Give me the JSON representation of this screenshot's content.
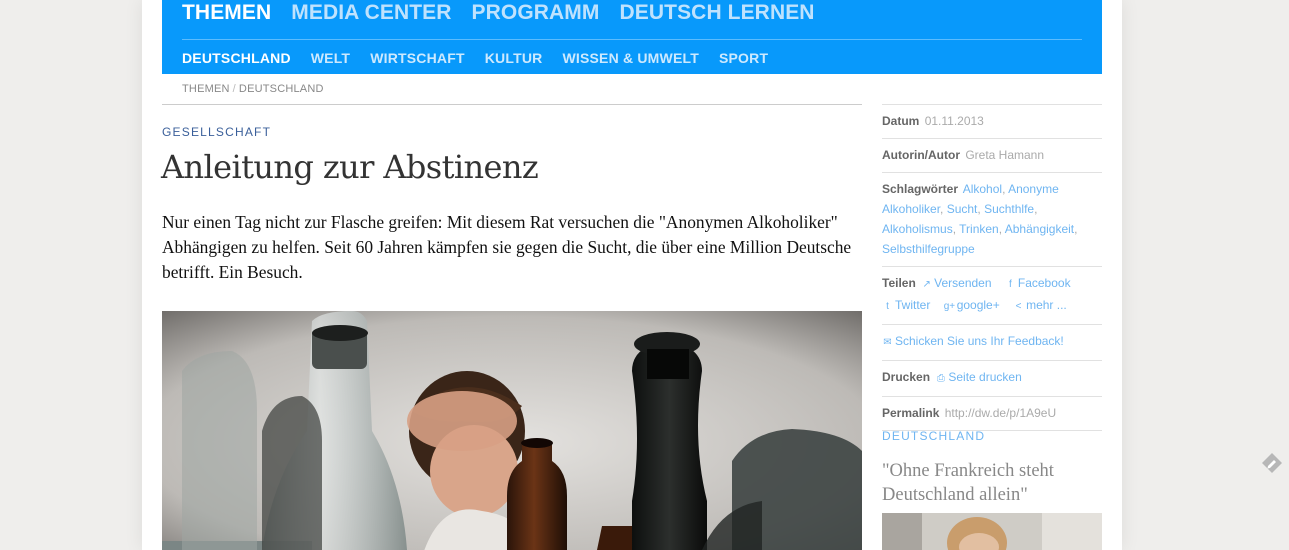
{
  "nav": {
    "main": [
      "THEMEN",
      "MEDIA CENTER",
      "PROGRAMM",
      "DEUTSCH LERNEN"
    ],
    "sub": [
      "DEUTSCHLAND",
      "WELT",
      "WIRTSCHAFT",
      "KULTUR",
      "WISSEN & UMWELT",
      "SPORT"
    ]
  },
  "breadcrumb": {
    "part1": "THEMEN",
    "sep": "/",
    "part2": "DEUTSCHLAND"
  },
  "article": {
    "kicker": "GESELLSCHAFT",
    "headline": "Anleitung zur Abstinenz",
    "teaser": "Nur einen Tag nicht zur Flasche greifen: Mit diesem Rat versuchen die \"Anonymen Alkoholiker\" Abhängigen zu helfen. Seit 60 Jahren kämpfen sie gegen die Sucht, die über eine Million Deutsche betrifft. Ein Besuch."
  },
  "sidebar": {
    "date_label": "Datum",
    "date_value": "01.11.2013",
    "author_label": "Autorin/Autor",
    "author_value": "Greta Hamann",
    "tags_label": "Schlagwörter",
    "tags": [
      "Alkohol",
      "Anonyme Alkoholiker",
      "Sucht",
      "Suchthlfe",
      "Alkoholismus",
      "Trinken",
      "Abhängigkeit",
      "Selbsthilfegruppe"
    ],
    "share_label": "Teilen",
    "share": {
      "send": "Versenden",
      "facebook": "Facebook",
      "twitter": "Twitter",
      "google": "google+",
      "more": "mehr ..."
    },
    "feedback": "Schicken Sie uns Ihr Feedback!",
    "print_label": "Drucken",
    "print_link": "Seite drucken",
    "permalink_label": "Permalink",
    "permalink_value": "http://dw.de/p/1A9eU",
    "related_kicker": "DEUTSCHLAND",
    "related_title": "\"Ohne Frankreich steht Deutschland allein\""
  },
  "icons": {
    "send": "external-link-icon",
    "facebook": "facebook-icon",
    "twitter": "twitter-icon",
    "google": "google-plus-icon",
    "more": "share-icon",
    "feedback": "mail-icon",
    "print": "printer-icon",
    "edge": "pencil-icon"
  },
  "colors": {
    "nav_bg": "#0899fb",
    "link": "#6fb5f1",
    "kicker": "#3a5f9a"
  }
}
